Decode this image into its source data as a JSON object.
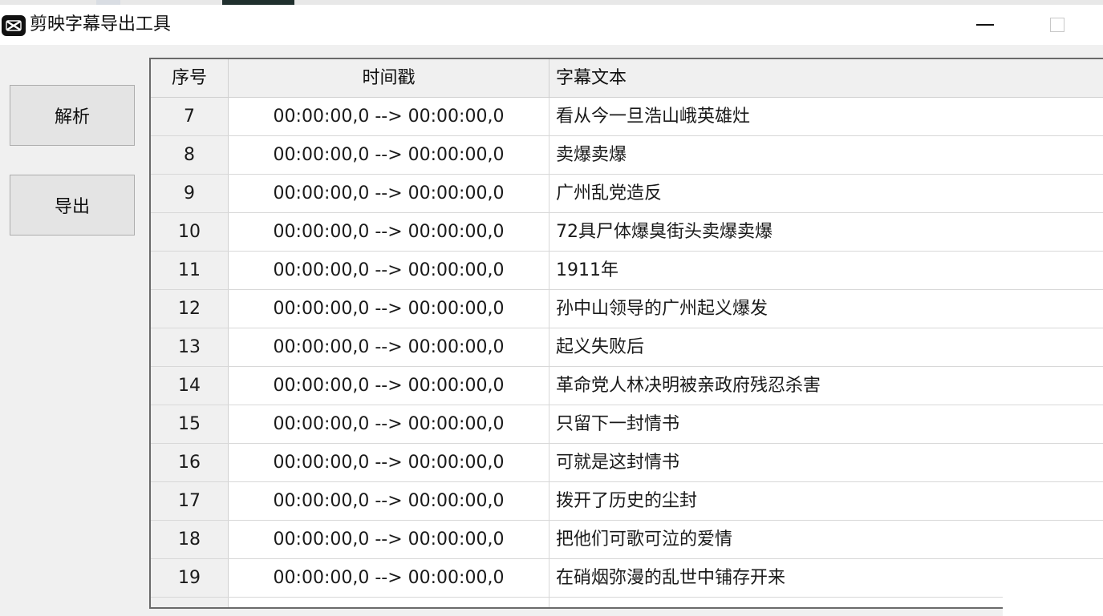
{
  "window": {
    "title": "剪映字幕导出工具"
  },
  "buttons": {
    "parse_label": "解析",
    "export_label": "导出"
  },
  "table": {
    "columns": [
      "序号",
      "时间戳",
      "字幕文本"
    ],
    "rows": [
      {
        "index": "7",
        "timestamp": "00:00:00,0 --> 00:00:00,0",
        "text": "看从今一旦浩山峨英雄灶"
      },
      {
        "index": "8",
        "timestamp": "00:00:00,0 --> 00:00:00,0",
        "text": "卖爆卖爆"
      },
      {
        "index": "9",
        "timestamp": "00:00:00,0 --> 00:00:00,0",
        "text": "广州乱党造反"
      },
      {
        "index": "10",
        "timestamp": "00:00:00,0 --> 00:00:00,0",
        "text": "72具尸体爆臭街头卖爆卖爆"
      },
      {
        "index": "11",
        "timestamp": "00:00:00,0 --> 00:00:00,0",
        "text": "1911年"
      },
      {
        "index": "12",
        "timestamp": "00:00:00,0 --> 00:00:00,0",
        "text": "孙中山领导的广州起义爆发"
      },
      {
        "index": "13",
        "timestamp": "00:00:00,0 --> 00:00:00,0",
        "text": "起义失败后"
      },
      {
        "index": "14",
        "timestamp": "00:00:00,0 --> 00:00:00,0",
        "text": "革命党人林决明被亲政府残忍杀害"
      },
      {
        "index": "15",
        "timestamp": "00:00:00,0 --> 00:00:00,0",
        "text": "只留下一封情书"
      },
      {
        "index": "16",
        "timestamp": "00:00:00,0 --> 00:00:00,0",
        "text": "可就是这封情书"
      },
      {
        "index": "17",
        "timestamp": "00:00:00,0 --> 00:00:00,0",
        "text": "拨开了历史的尘封"
      },
      {
        "index": "18",
        "timestamp": "00:00:00,0 --> 00:00:00,0",
        "text": "把他们可歌可泣的爱情"
      },
      {
        "index": "19",
        "timestamp": "00:00:00,0 --> 00:00:00,0",
        "text": "在硝烟弥漫的乱世中铺存开来"
      }
    ]
  },
  "colors": {
    "background": "#f0f0f0",
    "titlebar": "#ffffff",
    "grid_line": "#d8d8d8",
    "button_face": "#e4e4e4"
  }
}
